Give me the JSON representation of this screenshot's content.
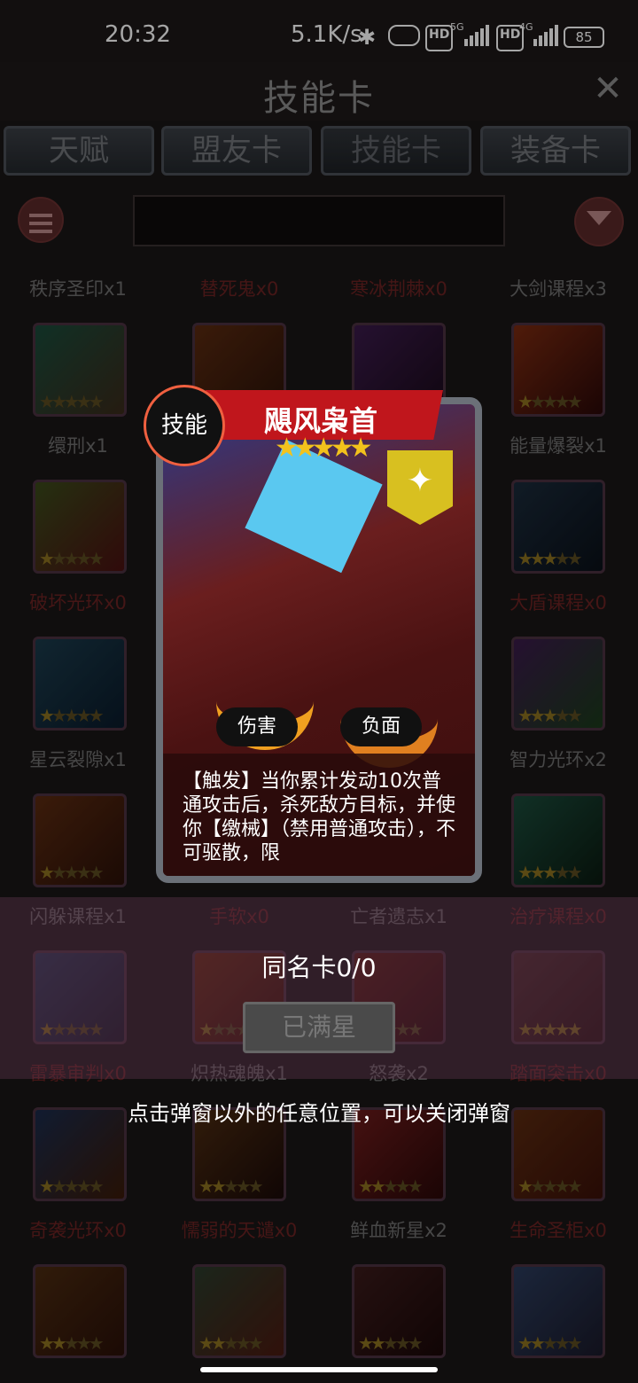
{
  "status": {
    "time": "20:32",
    "speed": "5.1K/s",
    "battery": "85",
    "net5g": "5G",
    "net4g": "4G",
    "hd": "HD"
  },
  "header": {
    "title": "技能卡",
    "close": "✕"
  },
  "tabs": [
    "天赋",
    "盟友卡",
    "技能卡",
    "装备卡"
  ],
  "grid": {
    "rows": [
      [
        "秩序圣印x1",
        "替死鬼x0",
        "寒冰荆棘x0",
        "大剑课程x3"
      ],
      [
        "缳刑x1",
        "",
        "",
        "能量爆裂x1"
      ],
      [
        "破坏光环x0",
        "",
        "",
        "大盾课程x0"
      ],
      [
        "星云裂隙x1",
        "",
        "",
        "智力光环x2"
      ],
      [
        "闪躲课程x1",
        "手软x0",
        "亡者遗志x1",
        "治疗课程x0"
      ],
      [
        "雷暴审判x0",
        "炽热魂魄x1",
        "怒袭x2",
        "踏面突击x0"
      ],
      [
        "奇袭光环x0",
        "懦弱的天谴x0",
        "鲜血新星x2",
        "生命圣柜x0"
      ]
    ]
  },
  "card": {
    "name": "飓风枭首",
    "type": "技能",
    "stars": "★★★★★",
    "tags": [
      "伤害",
      "负面"
    ],
    "description": "【触发】当你累计发动10次普通攻击后，杀死敌方目标，并使你【缴械】（禁用普通攻击），不可驱散，限"
  },
  "same_card": "同名卡0/0",
  "full_star_button": "已满星",
  "hint": "点击弹窗以外的任意位置，可以关闭弹窗"
}
